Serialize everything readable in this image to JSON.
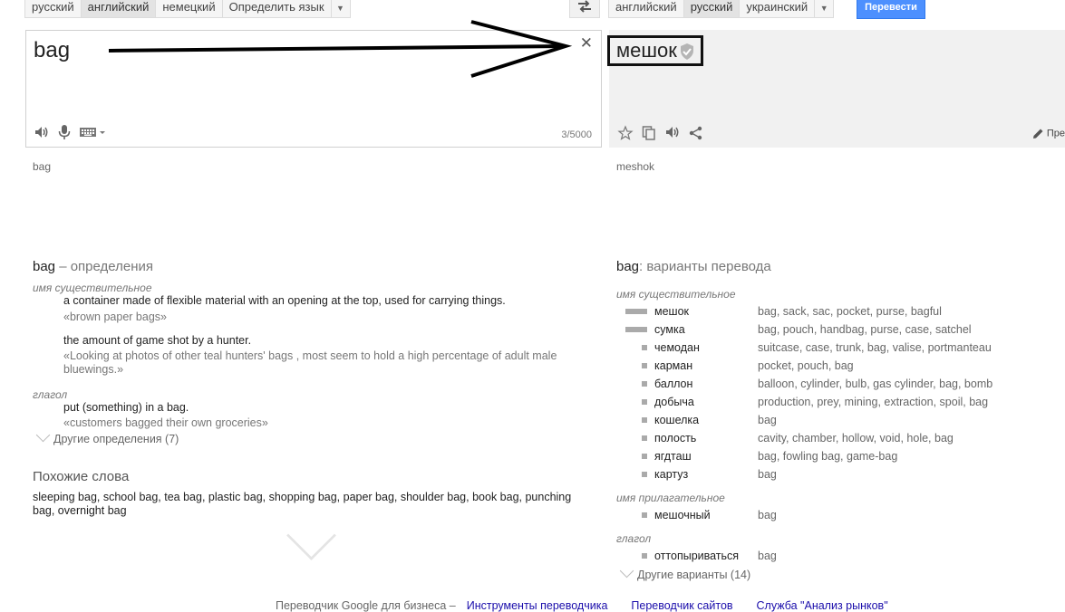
{
  "source_langs": [
    "русский",
    "английский",
    "немецкий",
    "Определить язык"
  ],
  "source_selected": 1,
  "target_langs": [
    "английский",
    "русский",
    "украинский"
  ],
  "target_selected": 1,
  "translate_button": "Перевести",
  "source": {
    "text": "bag",
    "count": "3/5000",
    "translit": "bag"
  },
  "result": {
    "text": "мешок",
    "translit": "meshok",
    "suggest": "Пре"
  },
  "definitions": {
    "title_word": "bag",
    "title_rest": " – определения",
    "noun_label": "имя существительное",
    "noun_defs": [
      {
        "def": "a container made of flexible material with an opening at the top, used for carrying things.",
        "ex": "«brown paper bags»"
      },
      {
        "def": "the amount of game shot by a hunter.",
        "ex": "«Looking at photos of other teal hunters' bags , most seem to hold a high percentage of adult male bluewings.»"
      }
    ],
    "verb_label": "глагол",
    "verb_defs": [
      {
        "def": "put (something) in a bag.",
        "ex": "«customers bagged their own groceries»"
      }
    ],
    "more": "Другие определения (7)"
  },
  "related": {
    "title": "Похожие слова",
    "text": "sleeping bag, school bag, tea bag, plastic bag, shopping bag, paper bag, shoulder bag, book bag, punching bag, overnight bag"
  },
  "translations": {
    "title_word": "bag",
    "title_rest": ": варианты перевода",
    "noun_label": "имя существительное",
    "noun": [
      {
        "word": "мешок",
        "syn": "bag, sack, sac, pocket, purse, bagful",
        "freq": 3
      },
      {
        "word": "сумка",
        "syn": "bag, pouch, handbag, purse, case, satchel",
        "freq": 3
      },
      {
        "word": "чемодан",
        "syn": "suitcase, case, trunk, bag, valise, portmanteau",
        "freq": 1
      },
      {
        "word": "карман",
        "syn": "pocket, pouch, bag",
        "freq": 1
      },
      {
        "word": "баллон",
        "syn": "balloon, cylinder, bulb, gas cylinder, bag, bomb",
        "freq": 1
      },
      {
        "word": "добыча",
        "syn": "production, prey, mining, extraction, spoil, bag",
        "freq": 1
      },
      {
        "word": "кошелка",
        "syn": "bag",
        "freq": 1
      },
      {
        "word": "полость",
        "syn": "cavity, chamber, hollow, void, hole, bag",
        "freq": 1
      },
      {
        "word": "ягдташ",
        "syn": "bag, fowling bag, game-bag",
        "freq": 1
      },
      {
        "word": "картуз",
        "syn": "bag",
        "freq": 1
      }
    ],
    "adj_label": "имя прилагательное",
    "adj": [
      {
        "word": "мешочный",
        "syn": "bag",
        "freq": 1
      }
    ],
    "verb_label": "глагол",
    "verb": [
      {
        "word": "оттопыриваться",
        "syn": "bag",
        "freq": 1
      }
    ],
    "more": "Другие варианты (14)"
  },
  "footer": {
    "prefix": "Переводчик Google для бизнеса –",
    "links": [
      "Инструменты переводчика",
      "Переводчик сайтов",
      "Служба \"Анализ рынков\""
    ]
  }
}
